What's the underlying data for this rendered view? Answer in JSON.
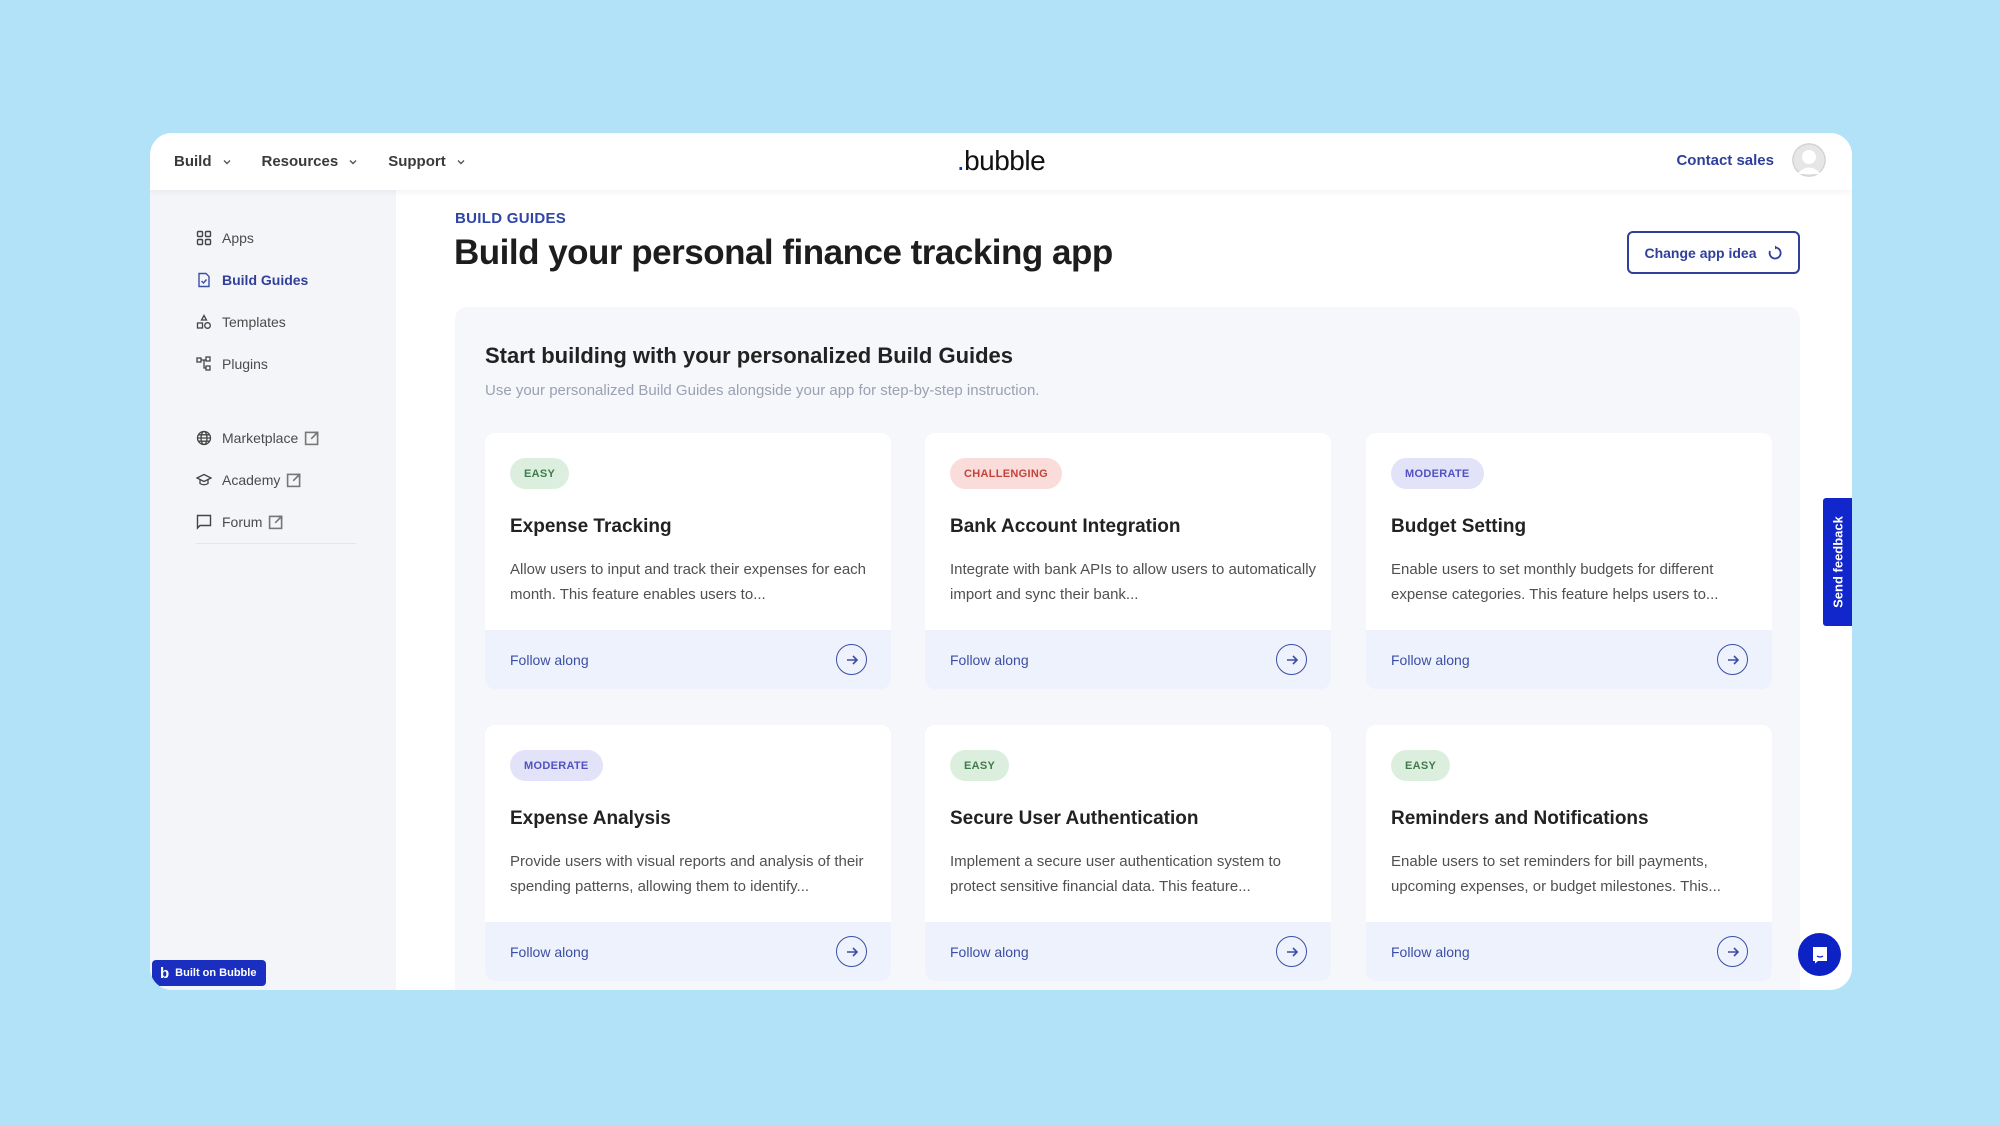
{
  "topbar": {
    "nav": [
      {
        "label": "Build"
      },
      {
        "label": "Resources"
      },
      {
        "label": "Support"
      }
    ],
    "logo_dot": ".",
    "logo_text": "bubble",
    "contact_label": "Contact sales"
  },
  "sidebar": {
    "items": [
      {
        "label": "Apps",
        "icon": "apps-grid-icon"
      },
      {
        "label": "Build Guides",
        "icon": "document-check-icon",
        "active": true
      },
      {
        "label": "Templates",
        "icon": "shapes-icon"
      },
      {
        "label": "Plugins",
        "icon": "plugin-tree-icon"
      }
    ],
    "external": [
      {
        "label": "Marketplace",
        "icon": "globe-icon"
      },
      {
        "label": "Academy",
        "icon": "graduation-cap-icon"
      },
      {
        "label": "Forum",
        "icon": "chat-square-icon"
      }
    ],
    "built_on_label": "Built on Bubble"
  },
  "main": {
    "breadcrumb": "BUILD GUIDES",
    "title": "Build your personal finance tracking app",
    "change_button": "Change app idea",
    "panel": {
      "title": "Start building with your personalized Build Guides",
      "subtitle": "Use your personalized Build Guides alongside your app for step-by-step instruction."
    },
    "cards": [
      {
        "difficulty": "EASY",
        "title": "Expense Tracking",
        "description": "Allow users to input and track their expenses for each month. This feature enables users to...",
        "action": "Follow along"
      },
      {
        "difficulty": "CHALLENGING",
        "title": "Bank Account Integration",
        "description": "Integrate with bank APIs to allow users to automatically import and sync their bank...",
        "action": "Follow along"
      },
      {
        "difficulty": "MODERATE",
        "title": "Budget Setting",
        "description": "Enable users to set monthly budgets for different expense categories. This feature helps users to...",
        "action": "Follow along"
      },
      {
        "difficulty": "MODERATE",
        "title": "Expense Analysis",
        "description": "Provide users with visual reports and analysis of their spending patterns, allowing them to identify...",
        "action": "Follow along"
      },
      {
        "difficulty": "EASY",
        "title": "Secure User Authentication",
        "description": "Implement a secure user authentication system to protect sensitive financial data. This feature...",
        "action": "Follow along"
      },
      {
        "difficulty": "EASY",
        "title": "Reminders and Notifications",
        "description": "Enable users to set reminders for bill payments, upcoming expenses, or budget milestones. This...",
        "action": "Follow along"
      }
    ]
  },
  "badge_colors": {
    "EASY": {
      "bg": "#dcefdf",
      "fg": "#3f7b4c"
    },
    "CHALLENGING": {
      "bg": "#fadcda",
      "fg": "#c2443b"
    },
    "MODERATE": {
      "bg": "#e2e2f8",
      "fg": "#5152c2"
    }
  },
  "feedback_label": "Send feedback",
  "colors": {
    "accent": "#2f3f9a",
    "brand_blue": "#1127cc",
    "background": "#b2e2f8"
  }
}
